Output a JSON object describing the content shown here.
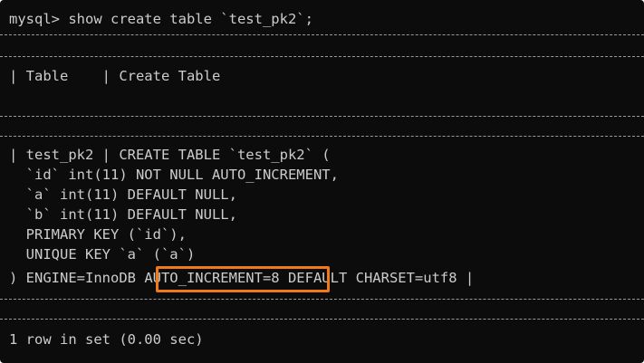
{
  "terminal": {
    "prompt_line": "mysql> show create table `test_pk2`;",
    "header_row": "| Table    | Create Table",
    "body_lines": [
      "| test_pk2 | CREATE TABLE `test_pk2` (",
      "  `id` int(11) NOT NULL AUTO_INCREMENT,",
      "  `a` int(11) DEFAULT NULL,",
      "  `b` int(11) DEFAULT NULL,",
      "  PRIMARY KEY (`id`),",
      "  UNIQUE KEY `a` (`a`)"
    ],
    "engine_prefix": ") ENGINE=InnoDB ",
    "engine_highlight": "AUTO_INCREMENT=8",
    "engine_suffix": " DEFAULT CHARSET=utf8 |",
    "result_line": "1 row in set (0.00 sec)"
  },
  "colors": {
    "background": "#0c0c0c",
    "text": "#cccccc",
    "highlight_border": "#f07a1a"
  }
}
